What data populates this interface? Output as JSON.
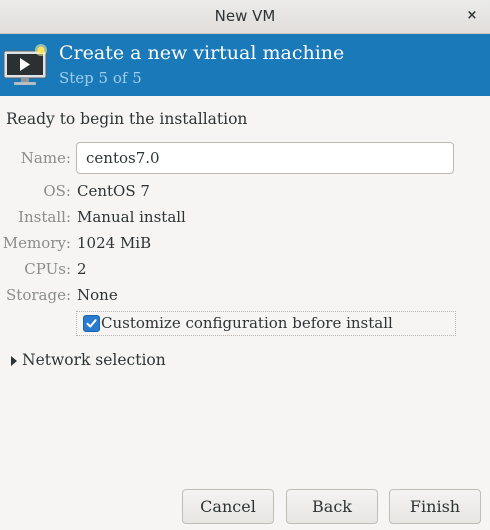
{
  "window": {
    "title": "New VM",
    "close_glyph": "×"
  },
  "banner": {
    "heading": "Create a new virtual machine",
    "step": "Step 5 of 5",
    "icon": "vm-console-icon"
  },
  "summary": {
    "ready_text": "Ready to begin the installation",
    "name_label": "Name:",
    "name_value": "centos7.0",
    "rows": [
      {
        "label": "OS:",
        "value": "CentOS 7"
      },
      {
        "label": "Install:",
        "value": "Manual install"
      },
      {
        "label": "Memory:",
        "value": "1024 MiB"
      },
      {
        "label": "CPUs:",
        "value": "2"
      },
      {
        "label": "Storage:",
        "value": "None"
      }
    ],
    "customize_label": "Customize configuration before install",
    "customize_checked": true
  },
  "network": {
    "label": "Network selection",
    "expanded": false
  },
  "buttons": {
    "cancel": "Cancel",
    "back": "Back",
    "finish": "Finish"
  },
  "colors": {
    "banner_bg": "#1a79b8",
    "banner_subtitle": "#9fcdee",
    "checkbox_accent": "#2a7ad0"
  }
}
